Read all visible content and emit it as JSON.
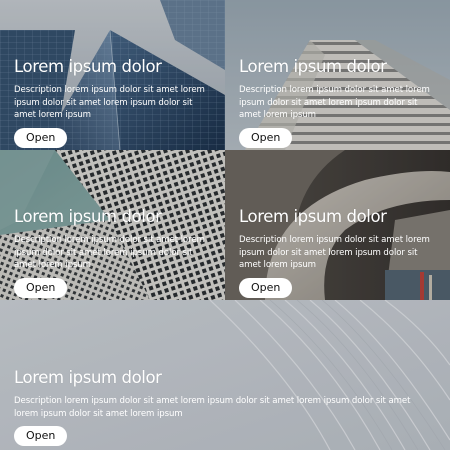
{
  "cards": [
    {
      "title": "Lorem ipsum dolor",
      "description": "Description lorem ipsum dolor sit amet lorem ipsum dolor sit amet lorem ipsum dolor sit amet lorem ipsum",
      "button_label": "Open",
      "image": "glass-skyscraper-photo"
    },
    {
      "title": "Lorem ipsum dolor",
      "description": "Description lorem ipsum dolor sit amet lorem ipsum dolor sit amet lorem ipsum dolor sit amet lorem ipsum",
      "button_label": "Open",
      "image": "white-building-balconies-photo"
    },
    {
      "title": "Lorem ipsum dolor",
      "description": "Description lorem ipsum dolor sit amet lorem ipsum dolor sit amet lorem ipsum dolor sit amet lorem ipsum",
      "button_label": "Open",
      "image": "patterned-facade-photo"
    },
    {
      "title": "Lorem ipsum dolor",
      "description": "Description lorem ipsum dolor sit amet lorem ipsum dolor sit amet lorem ipsum dolor sit amet lorem ipsum",
      "button_label": "Open",
      "image": "curved-staircase-photo"
    },
    {
      "title": "Lorem ipsum dolor",
      "description": "Description lorem ipsum dolor sit amet lorem ipsum dolor sit amet lorem ipsum dolor sit amet lorem ipsum dolor sit amet lorem ipsum",
      "button_label": "Open",
      "image": "abstract-curves-photo"
    }
  ]
}
